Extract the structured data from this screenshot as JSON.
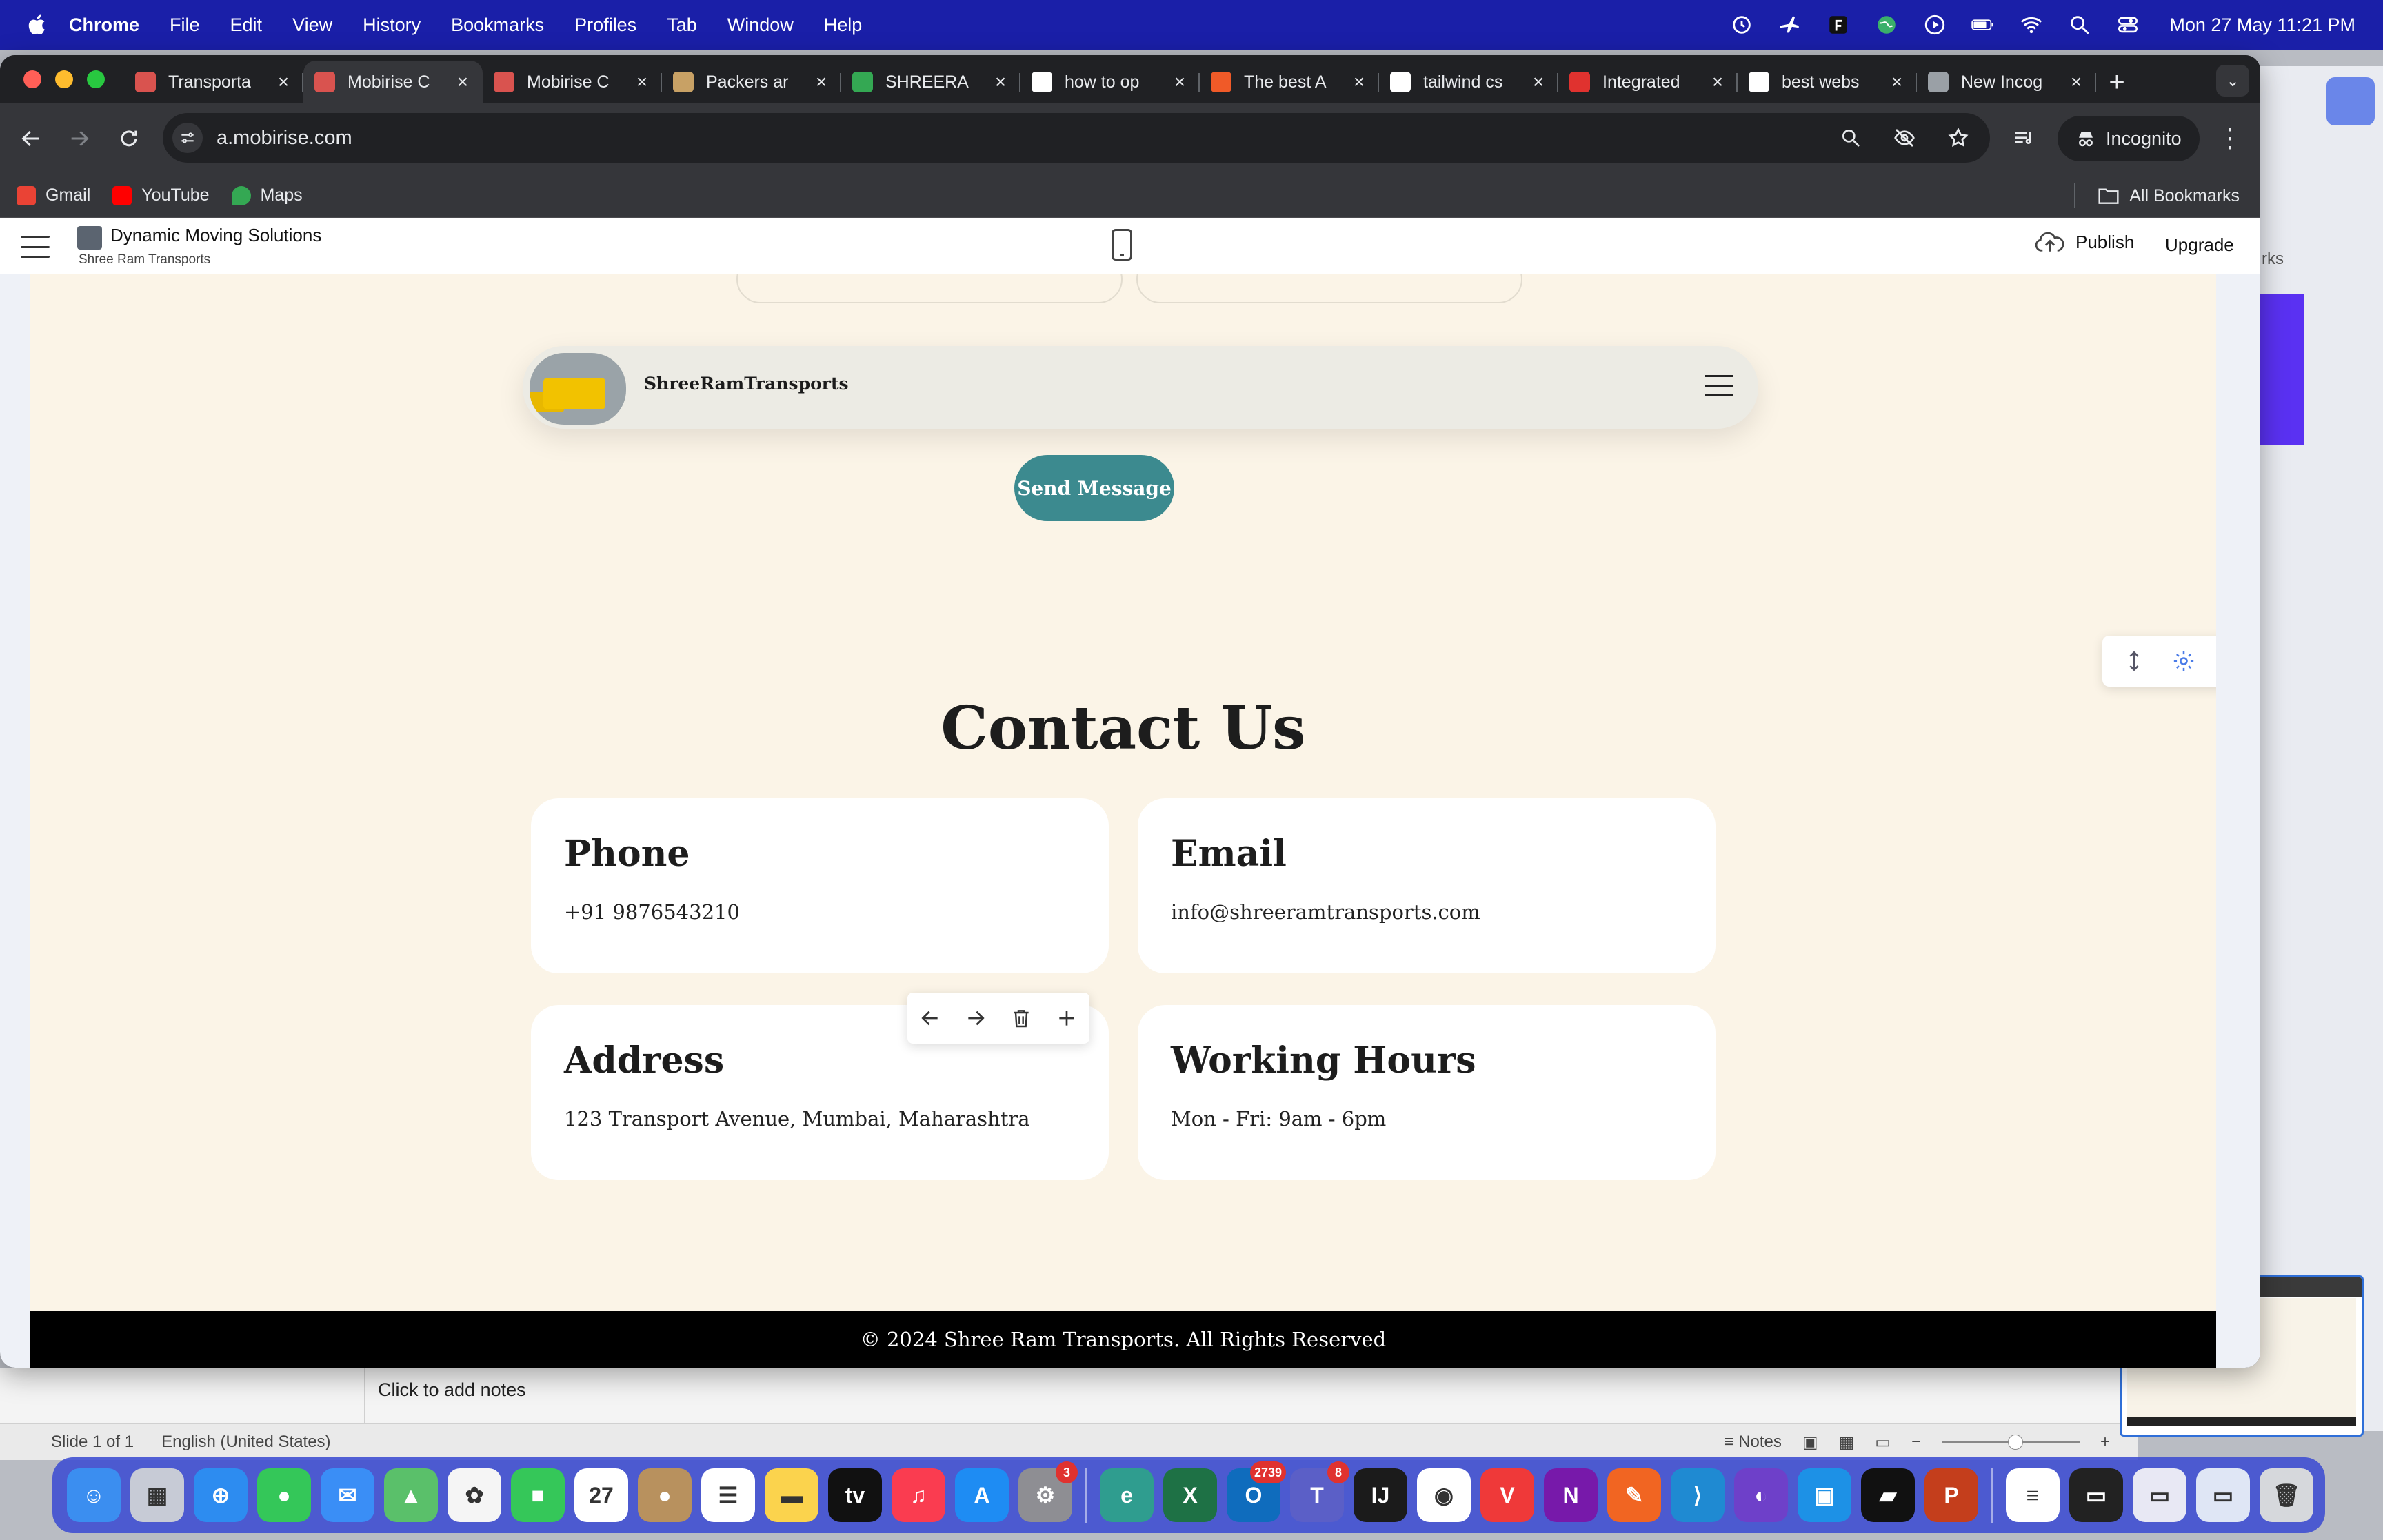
{
  "menubar": {
    "app": "Chrome",
    "items": [
      "File",
      "Edit",
      "View",
      "History",
      "Bookmarks",
      "Profiles",
      "Tab",
      "Window",
      "Help"
    ],
    "clock": "Mon 27 May  11:21 PM"
  },
  "browser": {
    "tabs": [
      {
        "title": "Transporta",
        "favicon_color": "#d9534f"
      },
      {
        "title": "Mobirise C",
        "favicon_color": "#d9534f"
      },
      {
        "title": "Mobirise C",
        "favicon_color": "#d9534f"
      },
      {
        "title": "Packers ar",
        "favicon_color": "#c8a165"
      },
      {
        "title": "SHREERA",
        "favicon_color": "#34a853"
      },
      {
        "title": "how to op",
        "favicon_color": "#ffffff"
      },
      {
        "title": "The best A",
        "favicon_color": "#f05a28"
      },
      {
        "title": "tailwind cs",
        "favicon_color": "#ffffff"
      },
      {
        "title": "Integrated",
        "favicon_color": "#e0322f"
      },
      {
        "title": "best webs",
        "favicon_color": "#ffffff"
      },
      {
        "title": "New Incog",
        "favicon_color": "#9aa0a6"
      }
    ],
    "active_tab_index": 1,
    "url": "a.mobirise.com",
    "incognito_label": "Incognito",
    "bookmarks": [
      "Gmail",
      "YouTube",
      "Maps"
    ],
    "all_bookmarks": "All Bookmarks"
  },
  "editor": {
    "project_name": "Dynamic Moving Solutions",
    "project_sub": "Shree Ram Transports",
    "publish": "Publish",
    "upgrade": "Upgrade"
  },
  "site": {
    "brand": "ShreeRamTransports",
    "send_button": "Send Message",
    "contact_title": "Contact Us",
    "cards": [
      {
        "title": "Phone",
        "text": "+91 9876543210"
      },
      {
        "title": "Email",
        "text": "info@shreeramtransports.com"
      },
      {
        "title": "Address",
        "text": "123 Transport Avenue, Mumbai, Maharashtra"
      },
      {
        "title": "Working Hours",
        "text": "Mon - Fri: 9am - 6pm"
      }
    ],
    "footer": "© 2024 Shree Ram Transports. All Rights Reserved"
  },
  "powerpoint": {
    "notes_hint": "Click to add notes",
    "slide_info": "Slide 1 of 1",
    "language": "English (United States)",
    "notes_button": "Notes"
  },
  "background": {
    "partial_text": "rks"
  },
  "dock": {
    "apps": [
      {
        "name": "Finder",
        "color": "#3b8ef0",
        "glyph": "☺"
      },
      {
        "name": "Launchpad",
        "color": "#c7cbd6",
        "glyph": "▦"
      },
      {
        "name": "Safari",
        "color": "#2d8cf0",
        "glyph": "⊕"
      },
      {
        "name": "Messages",
        "color": "#34c759",
        "glyph": "●"
      },
      {
        "name": "Mail",
        "color": "#3a8ef6",
        "glyph": "✉"
      },
      {
        "name": "Maps",
        "color": "#5ac06a",
        "glyph": "▲"
      },
      {
        "name": "Photos",
        "color": "#f5f5f5",
        "glyph": "✿"
      },
      {
        "name": "FaceTime",
        "color": "#35c759",
        "glyph": "■"
      },
      {
        "name": "Calendar",
        "color": "#ffffff",
        "glyph": "27"
      },
      {
        "name": "Contacts",
        "color": "#b8915e",
        "glyph": "●"
      },
      {
        "name": "Reminders",
        "color": "#ffffff",
        "glyph": "☰"
      },
      {
        "name": "Notes",
        "color": "#fbd34d",
        "glyph": "▬"
      },
      {
        "name": "TV",
        "color": "#111111",
        "glyph": "tv"
      },
      {
        "name": "Music",
        "color": "#fa3c50",
        "glyph": "♫"
      },
      {
        "name": "App Store",
        "color": "#1e8cf3",
        "glyph": "A"
      },
      {
        "name": "System Settings",
        "color": "#8e8e93",
        "glyph": "⚙",
        "badge": "3"
      },
      {
        "name": "Edge",
        "color": "#2f9d8f",
        "glyph": "e"
      },
      {
        "name": "Excel",
        "color": "#1e7145",
        "glyph": "X"
      },
      {
        "name": "Outlook",
        "color": "#0f6cbd",
        "glyph": "O",
        "badge": "2739"
      },
      {
        "name": "Teams",
        "color": "#5b5fc7",
        "glyph": "T",
        "badge": "8"
      },
      {
        "name": "IntelliJ",
        "color": "#1b1b1b",
        "glyph": "IJ"
      },
      {
        "name": "Chrome",
        "color": "#ffffff",
        "glyph": "◉"
      },
      {
        "name": "Vivaldi",
        "color": "#ef3939",
        "glyph": "V"
      },
      {
        "name": "OneNote",
        "color": "#7719aa",
        "glyph": "N"
      },
      {
        "name": "Pencil",
        "color": "#f16522",
        "glyph": "✎"
      },
      {
        "name": "VS Code",
        "color": "#1f8ad2",
        "glyph": "⟩"
      },
      {
        "name": "GitHub Desktop",
        "color": "#6e40c9",
        "glyph": "◐"
      },
      {
        "name": "Docker",
        "color": "#1d91e6",
        "glyph": "▣"
      },
      {
        "name": "Terminal App",
        "color": "#111111",
        "glyph": "▰"
      },
      {
        "name": "PowerPoint",
        "color": "#c43e1c",
        "glyph": "P"
      },
      {
        "name": "Preview Doc",
        "color": "#ffffff",
        "glyph": "≡"
      },
      {
        "name": "Window Thumb 1",
        "color": "#222222",
        "glyph": "▭"
      },
      {
        "name": "Window Thumb 2",
        "color": "#e8e8f4",
        "glyph": "▭"
      },
      {
        "name": "Window Thumb 3",
        "color": "#dfe6f5",
        "glyph": "▭"
      },
      {
        "name": "Trash",
        "color": "#d6d8dc",
        "glyph": "🗑"
      }
    ]
  }
}
